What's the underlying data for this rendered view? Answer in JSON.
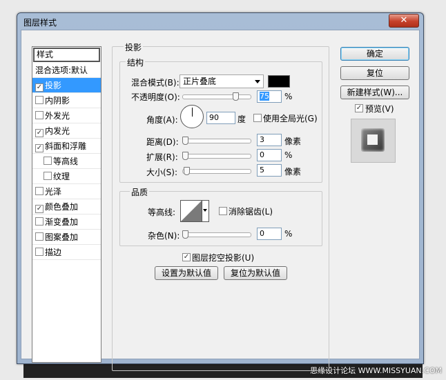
{
  "window": {
    "title": "图层样式",
    "close_label": "✕"
  },
  "styles_list": {
    "header": "样式",
    "items": [
      {
        "label": "混合选项:默认",
        "checkbox": null,
        "sub": false,
        "selected": false
      },
      {
        "label": "投影",
        "checkbox": true,
        "sub": false,
        "selected": true
      },
      {
        "label": "内阴影",
        "checkbox": false,
        "sub": false,
        "selected": false
      },
      {
        "label": "外发光",
        "checkbox": false,
        "sub": false,
        "selected": false
      },
      {
        "label": "内发光",
        "checkbox": true,
        "sub": false,
        "selected": false
      },
      {
        "label": "斜面和浮雕",
        "checkbox": true,
        "sub": false,
        "selected": false
      },
      {
        "label": "等高线",
        "checkbox": false,
        "sub": true,
        "selected": false
      },
      {
        "label": "纹理",
        "checkbox": false,
        "sub": true,
        "selected": false
      },
      {
        "label": "光泽",
        "checkbox": false,
        "sub": false,
        "selected": false
      },
      {
        "label": "颜色叠加",
        "checkbox": true,
        "sub": false,
        "selected": false
      },
      {
        "label": "渐变叠加",
        "checkbox": false,
        "sub": false,
        "selected": false
      },
      {
        "label": "图案叠加",
        "checkbox": false,
        "sub": false,
        "selected": false
      },
      {
        "label": "描边",
        "checkbox": false,
        "sub": false,
        "selected": false
      }
    ]
  },
  "drop_shadow": {
    "section_title": "投影",
    "structure": {
      "title": "结构",
      "blend_mode_label": "混合模式(B):",
      "blend_mode_value": "正片叠底",
      "shadow_color": "#000000",
      "opacity_label": "不透明度(O):",
      "opacity_value": "75",
      "opacity_unit": "%",
      "angle_label": "角度(A):",
      "angle_value": "90",
      "angle_unit": "度",
      "global_light_label": "使用全局光(G)",
      "global_light_checked": false,
      "distance_label": "距离(D):",
      "distance_value": "3",
      "distance_unit": "像素",
      "spread_label": "扩展(R):",
      "spread_value": "0",
      "spread_unit": "%",
      "size_label": "大小(S):",
      "size_value": "5",
      "size_unit": "像素"
    },
    "quality": {
      "title": "品质",
      "contour_label": "等高线:",
      "anti_alias_label": "消除锯齿(L)",
      "anti_alias_checked": false,
      "noise_label": "杂色(N):",
      "noise_value": "0",
      "noise_unit": "%"
    },
    "knockout_label": "图层挖空投影(U)",
    "knockout_checked": true,
    "make_default_label": "设置为默认值",
    "reset_default_label": "复位为默认值"
  },
  "buttons": {
    "ok": "确定",
    "reset": "复位",
    "new_style": "新建样式(W)...",
    "preview_label": "预览(V)",
    "preview_checked": true
  },
  "watermark": "思缘设计论坛 WWW.MISSYUAN.COM"
}
